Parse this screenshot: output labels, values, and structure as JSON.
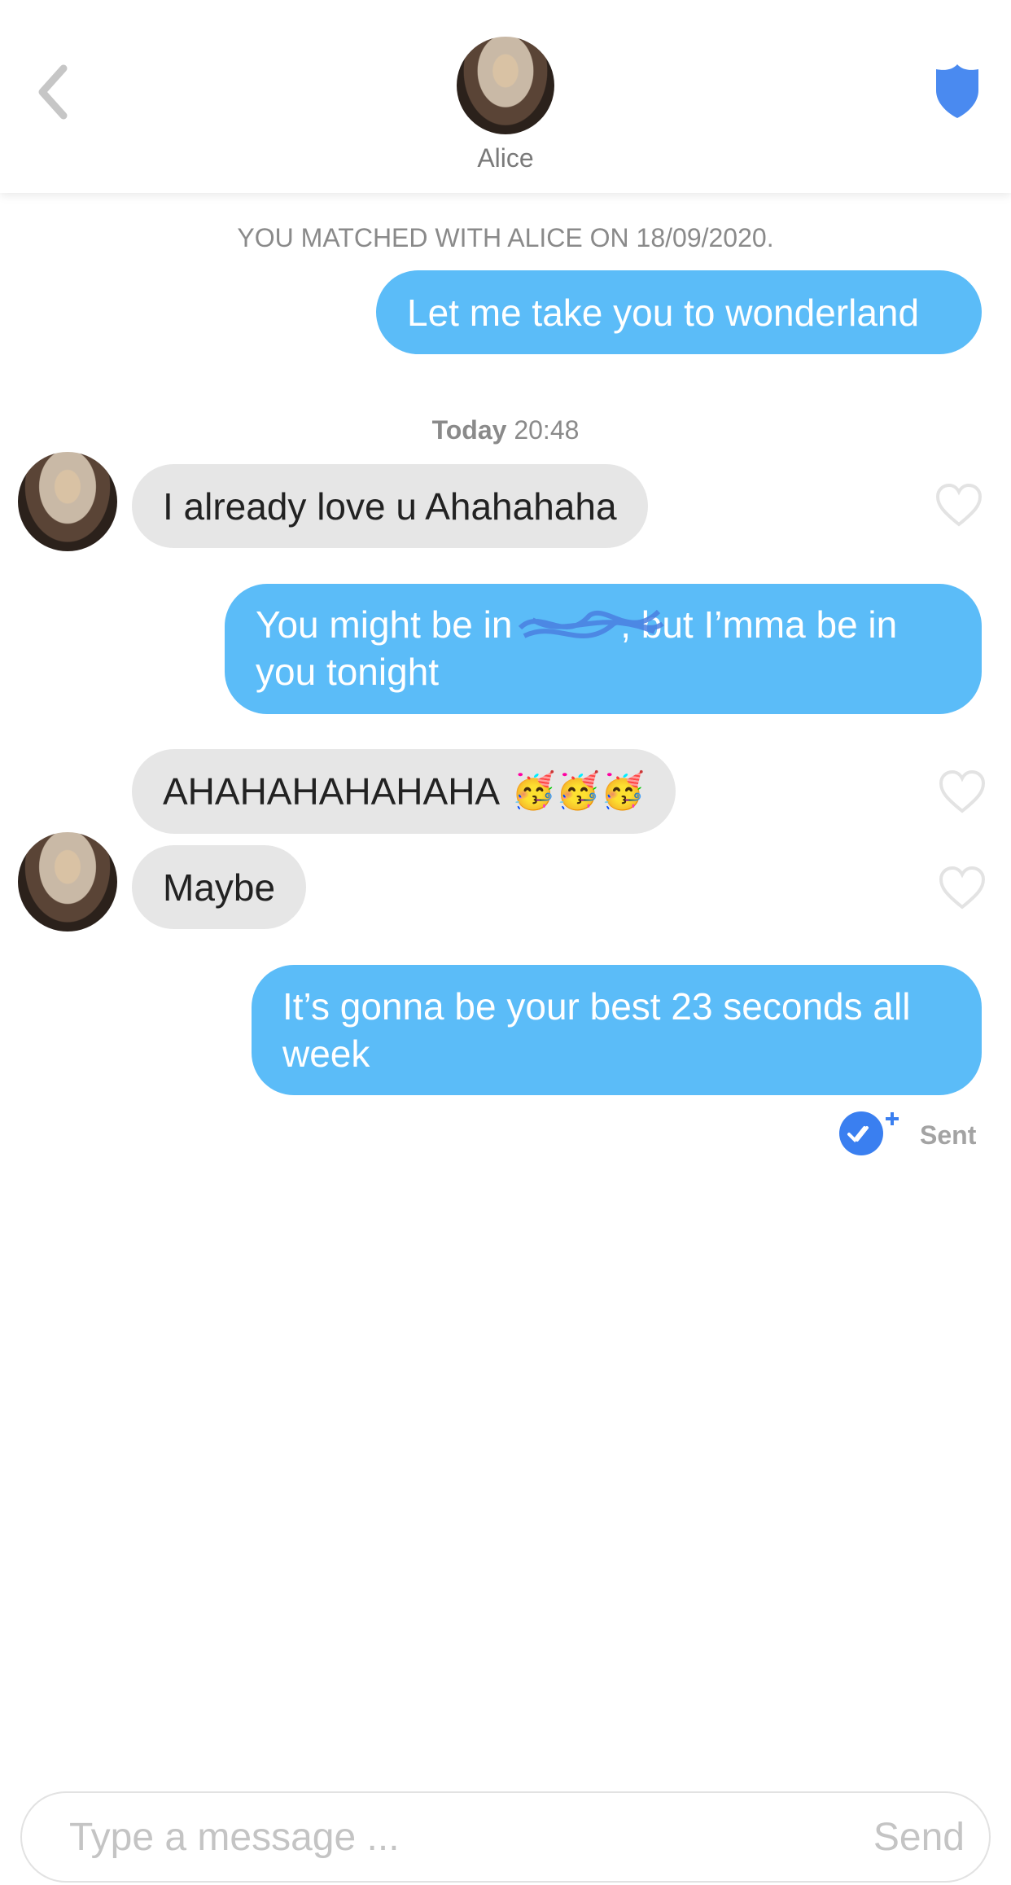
{
  "header": {
    "contact_name": "Alice",
    "back_icon": "chevron-left-icon",
    "safety_icon": "shield-icon",
    "accent": "#4a8af0"
  },
  "match_notice": "YOU MATCHED WITH ALICE ON 18/09/2020.",
  "timestamp": {
    "day": "Today",
    "time": "20:48"
  },
  "messages": [
    {
      "from": "me",
      "text": "Let me take you to wonderland"
    },
    {
      "from": "Alice",
      "text": "I already love u Ahahahaha"
    },
    {
      "from": "me",
      "text_before": "You might be in ",
      "text_after": ", but I’mma be in you tonight"
    },
    {
      "from": "Alice",
      "text": "AHAHAHAHAHAHA",
      "emoji": "🥳🥳🥳"
    },
    {
      "from": "Alice",
      "text": "Maybe"
    },
    {
      "from": "me",
      "text": "It’s gonna be your best 23 seconds all week"
    }
  ],
  "status": {
    "label": "Sent",
    "icon": "double-check-icon"
  },
  "composer": {
    "placeholder": "Type a message ...",
    "send_label": "Send"
  },
  "colors": {
    "outgoing": "#5bbcf8",
    "incoming": "#e6e6e6"
  }
}
